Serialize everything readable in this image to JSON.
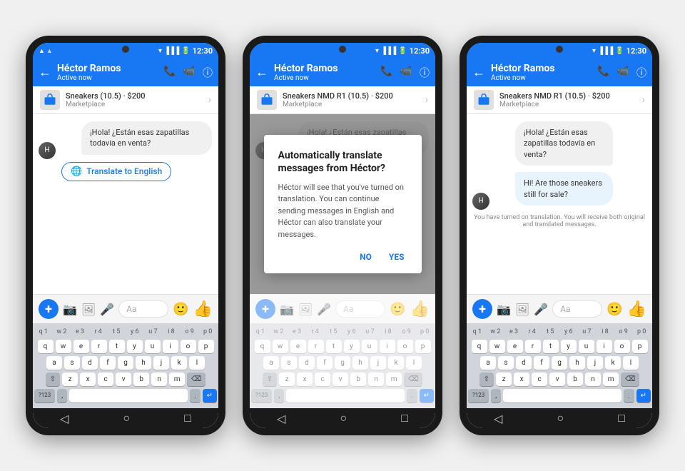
{
  "page": {
    "background": "#f0f0f0"
  },
  "phone1": {
    "time": "12:30",
    "contact_name": "Héctor Ramos",
    "contact_status": "Active now",
    "marketplace_title": "Sneakers (10.5) · $200",
    "marketplace_sub": "Marketplace",
    "message1": "¡Hola! ¿Están esas zapatillas todavía en venta?",
    "translate_btn": "Translate to English",
    "input_placeholder": "Aa",
    "back_label": "←",
    "phone_icon": "📞",
    "video_icon": "📹",
    "info_icon": "ⓘ"
  },
  "phone2": {
    "time": "12:30",
    "contact_name": "Héctor Ramos",
    "contact_status": "Active now",
    "marketplace_title": "Sneakers NMD R1 (10.5) · $200",
    "marketplace_sub": "Marketplace",
    "dialog_title": "Automatically translate messages from Héctor?",
    "dialog_body": "Héctor will see that you've turned on translation. You can continue sending messages in English and Héctor can also translate your messages.",
    "dialog_no": "NO",
    "dialog_yes": "YES",
    "input_placeholder": "Aa"
  },
  "phone3": {
    "time": "12:30",
    "contact_name": "Héctor Ramos",
    "contact_status": "Active now",
    "marketplace_title": "Sneakers NMD R1 (10.5) · $200",
    "marketplace_sub": "Marketplace",
    "message_original": "¡Hola! ¿Están esas zapatillas todavía en venta?",
    "message_translated": "Hi! Are those sneakers still for sale?",
    "translation_notice": "You have turned on translation. You will receive both original and translated messages.",
    "input_placeholder": "Aa"
  },
  "keyboard": {
    "row1": [
      "q",
      "w",
      "e",
      "r",
      "t",
      "y",
      "u",
      "i",
      "o",
      "p"
    ],
    "row2": [
      "a",
      "s",
      "d",
      "f",
      "g",
      "h",
      "j",
      "k",
      "l"
    ],
    "row3": [
      "z",
      "x",
      "c",
      "v",
      "b",
      "n",
      "m"
    ],
    "numbers": [
      "1",
      "2",
      "3",
      "4",
      "5",
      "6",
      "7",
      "8",
      "9",
      "0"
    ],
    "special_left": "?123",
    "special_right": "."
  }
}
